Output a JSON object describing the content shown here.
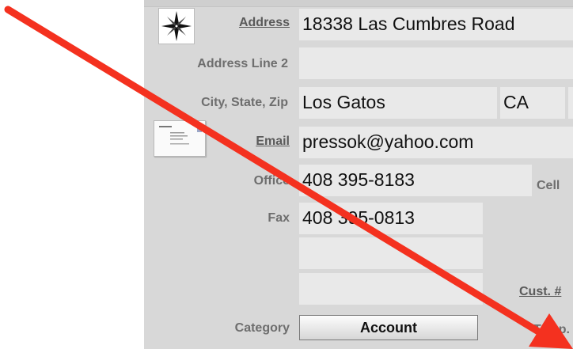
{
  "contact": {
    "address_label": "Address",
    "address_value": "18338 Las Cumbres Road",
    "address2_label": "Address Line 2",
    "address2_value": "",
    "city_label": "City, State, Zip",
    "city_value": "Los Gatos",
    "state_value": "CA",
    "zip_value": "",
    "email_label": "Email",
    "email_value": "pressok@yahoo.com",
    "office_label": "Office",
    "office_value": "408 395-8183",
    "cell_label": "Cell",
    "fax_label": "Fax",
    "fax_value": "408 395-0813",
    "extra1_value": "",
    "extra2_value": "",
    "cust_label": "Cust. #",
    "category_label": "Category",
    "category_value": "Account",
    "bottom_label_partial": "Temp."
  },
  "icons": {
    "compass": "compass-rose-icon",
    "card": "business-card-icon",
    "annotation": "red-arrow-annotation"
  },
  "colors": {
    "panel_bg": "#d8d8d8",
    "field_bg": "#e9e9e9",
    "label_text": "#6e6e6e",
    "arrow": "#f4311f"
  }
}
